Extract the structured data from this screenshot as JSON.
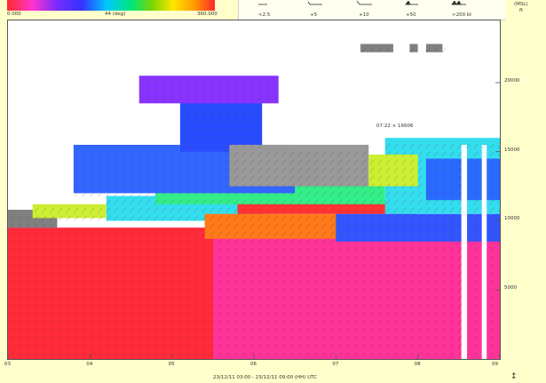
{
  "colorbar": {
    "min_label": "0.000",
    "mid_label": "44 (deg)",
    "max_label": "360.000"
  },
  "wind_key": {
    "labels": [
      "<2.5",
      "+5",
      "+10",
      "+50",
      ">200 kt"
    ]
  },
  "axis": {
    "y_unit_1": "(MSL)",
    "y_unit_2": "ft"
  },
  "xaxis_title": "23/12/11 03:00 - 23/12/11 09:00 (HH) UTC",
  "cursor_readout": "07:22 × 16606",
  "corner_icon": "↕",
  "chart_data": {
    "type": "heatmap",
    "x_ticks": [
      "03",
      "04",
      "05",
      "06",
      "07",
      "08",
      "09"
    ],
    "y_ticks": [
      "5000",
      "10000",
      "15000",
      "20000"
    ],
    "xlim": [
      3,
      9
    ],
    "ylim": [
      0,
      24500
    ],
    "color_scale": {
      "min": 0,
      "max": 360,
      "unit": "deg"
    },
    "bands": [
      {
        "x0": 3.0,
        "x1": 9.0,
        "y0": 0,
        "y1": 9500,
        "color": "#ff3399"
      },
      {
        "x0": 3.0,
        "x1": 5.5,
        "y0": 0,
        "y1": 9500,
        "color": "#ff2a3a"
      },
      {
        "x0": 3.0,
        "x1": 3.6,
        "y0": 9500,
        "y1": 10800,
        "color": "#808080"
      },
      {
        "x0": 3.3,
        "x1": 4.2,
        "y0": 10200,
        "y1": 11200,
        "color": "#ccee33"
      },
      {
        "x0": 4.2,
        "x1": 6.2,
        "y0": 10000,
        "y1": 11800,
        "color": "#33ddee"
      },
      {
        "x0": 5.4,
        "x1": 8.0,
        "y0": 8700,
        "y1": 10500,
        "color": "#ff7a1a"
      },
      {
        "x0": 5.8,
        "x1": 7.8,
        "y0": 10500,
        "y1": 11500,
        "color": "#ff3333"
      },
      {
        "x0": 4.8,
        "x1": 7.6,
        "y0": 11200,
        "y1": 12800,
        "color": "#33ee88"
      },
      {
        "x0": 7.0,
        "x1": 9.0,
        "y0": 8500,
        "y1": 10500,
        "color": "#3355ff"
      },
      {
        "x0": 3.8,
        "x1": 6.5,
        "y0": 12000,
        "y1": 15500,
        "color": "#3366ff"
      },
      {
        "x0": 5.1,
        "x1": 6.1,
        "y0": 15000,
        "y1": 18800,
        "color": "#2a4cff"
      },
      {
        "x0": 4.6,
        "x1": 6.3,
        "y0": 18500,
        "y1": 20500,
        "color": "#8833ff"
      },
      {
        "x0": 5.7,
        "x1": 7.4,
        "y0": 12500,
        "y1": 15500,
        "color": "#999999"
      },
      {
        "x0": 7.6,
        "x1": 9.0,
        "y0": 10500,
        "y1": 16000,
        "color": "#33ddee"
      },
      {
        "x0": 8.1,
        "x1": 9.0,
        "y0": 11500,
        "y1": 14500,
        "color": "#2a6bff"
      },
      {
        "x0": 7.4,
        "x1": 8.0,
        "y0": 12500,
        "y1": 14800,
        "color": "#ccee33"
      },
      {
        "x0": 7.3,
        "x1": 7.7,
        "y0": 22200,
        "y1": 22800,
        "color": "#808080"
      },
      {
        "x0": 7.9,
        "x1": 8.0,
        "y0": 22200,
        "y1": 22800,
        "color": "#808080"
      },
      {
        "x0": 8.1,
        "x1": 8.3,
        "y0": 22200,
        "y1": 22800,
        "color": "#808080"
      }
    ],
    "gaps": [
      {
        "x0": 8.53,
        "x1": 8.6,
        "y0": 0,
        "y1": 15500
      },
      {
        "x0": 8.78,
        "x1": 8.84,
        "y0": 0,
        "y1": 15500
      }
    ]
  }
}
